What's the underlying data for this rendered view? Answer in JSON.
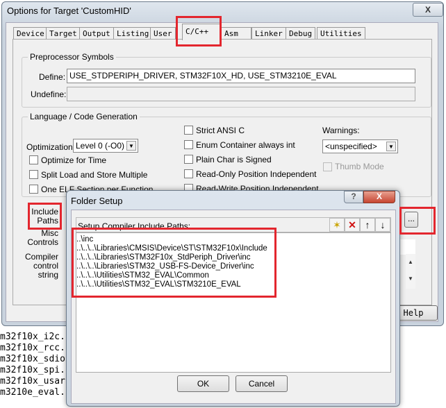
{
  "window": {
    "title": "Options for Target 'CustomHID'",
    "close": "X"
  },
  "tabs": [
    "Device",
    "Target",
    "Output",
    "Listing",
    "User",
    "C/C++",
    "Asm",
    "Linker",
    "Debug",
    "Utilities"
  ],
  "active_tab": "C/C++",
  "preprocessor": {
    "group": "Preprocessor Symbols",
    "define_label": "Define:",
    "define_value": "USE_STDPERIPH_DRIVER, STM32F10X_HD, USE_STM3210E_EVAL",
    "undefine_label": "Undefine:",
    "undefine_value": ""
  },
  "language": {
    "group": "Language / Code Generation",
    "optimization_label": "Optimization:",
    "optimization_value": "Level 0 (-O0)",
    "left_checks": [
      "Optimize for Time",
      "Split Load and Store Multiple",
      "One ELF Section per Function"
    ],
    "mid_checks": [
      "Strict ANSI C",
      "Enum Container always int",
      "Plain Char is Signed",
      "Read-Only Position Independent",
      "Read-Write Position Independent"
    ],
    "warnings_label": "Warnings:",
    "warnings_value": "<unspecified>",
    "thumb_mode": "Thumb Mode"
  },
  "include_paths_label": "Include Paths",
  "include_paths_l1": "Include",
  "include_paths_l2": "Paths",
  "misc_l1": "Misc",
  "misc_l2": "Controls",
  "compiler_l1": "Compiler",
  "compiler_l2": "control",
  "compiler_l3": "string",
  "browse_button": "...",
  "help_button": "Help",
  "background_code": [
    "m32f10x_i2c.",
    "m32f10x_rcc.",
    "m32f10x_sdio",
    "m32f10x_spi.",
    "m32f10x_usar",
    "m3210e_eval."
  ],
  "folder_setup": {
    "title": "Folder Setup",
    "help": "?",
    "close": "X",
    "header": "Setup Compiler Include Paths:",
    "paths": [
      "..\\inc",
      "..\\..\\..\\Libraries\\CMSIS\\Device\\ST\\STM32F10x\\Include",
      "..\\..\\..\\Libraries\\STM32F10x_StdPeriph_Driver\\inc",
      "..\\..\\..\\Libraries\\STM32_USB-FS-Device_Driver\\inc",
      "..\\..\\..\\Utilities\\STM32_EVAL\\Common",
      "..\\..\\..\\Utilities\\STM32_EVAL\\STM3210E_EVAL"
    ],
    "ok": "OK",
    "cancel": "Cancel"
  },
  "colors": {
    "highlight": "#e3262e"
  }
}
